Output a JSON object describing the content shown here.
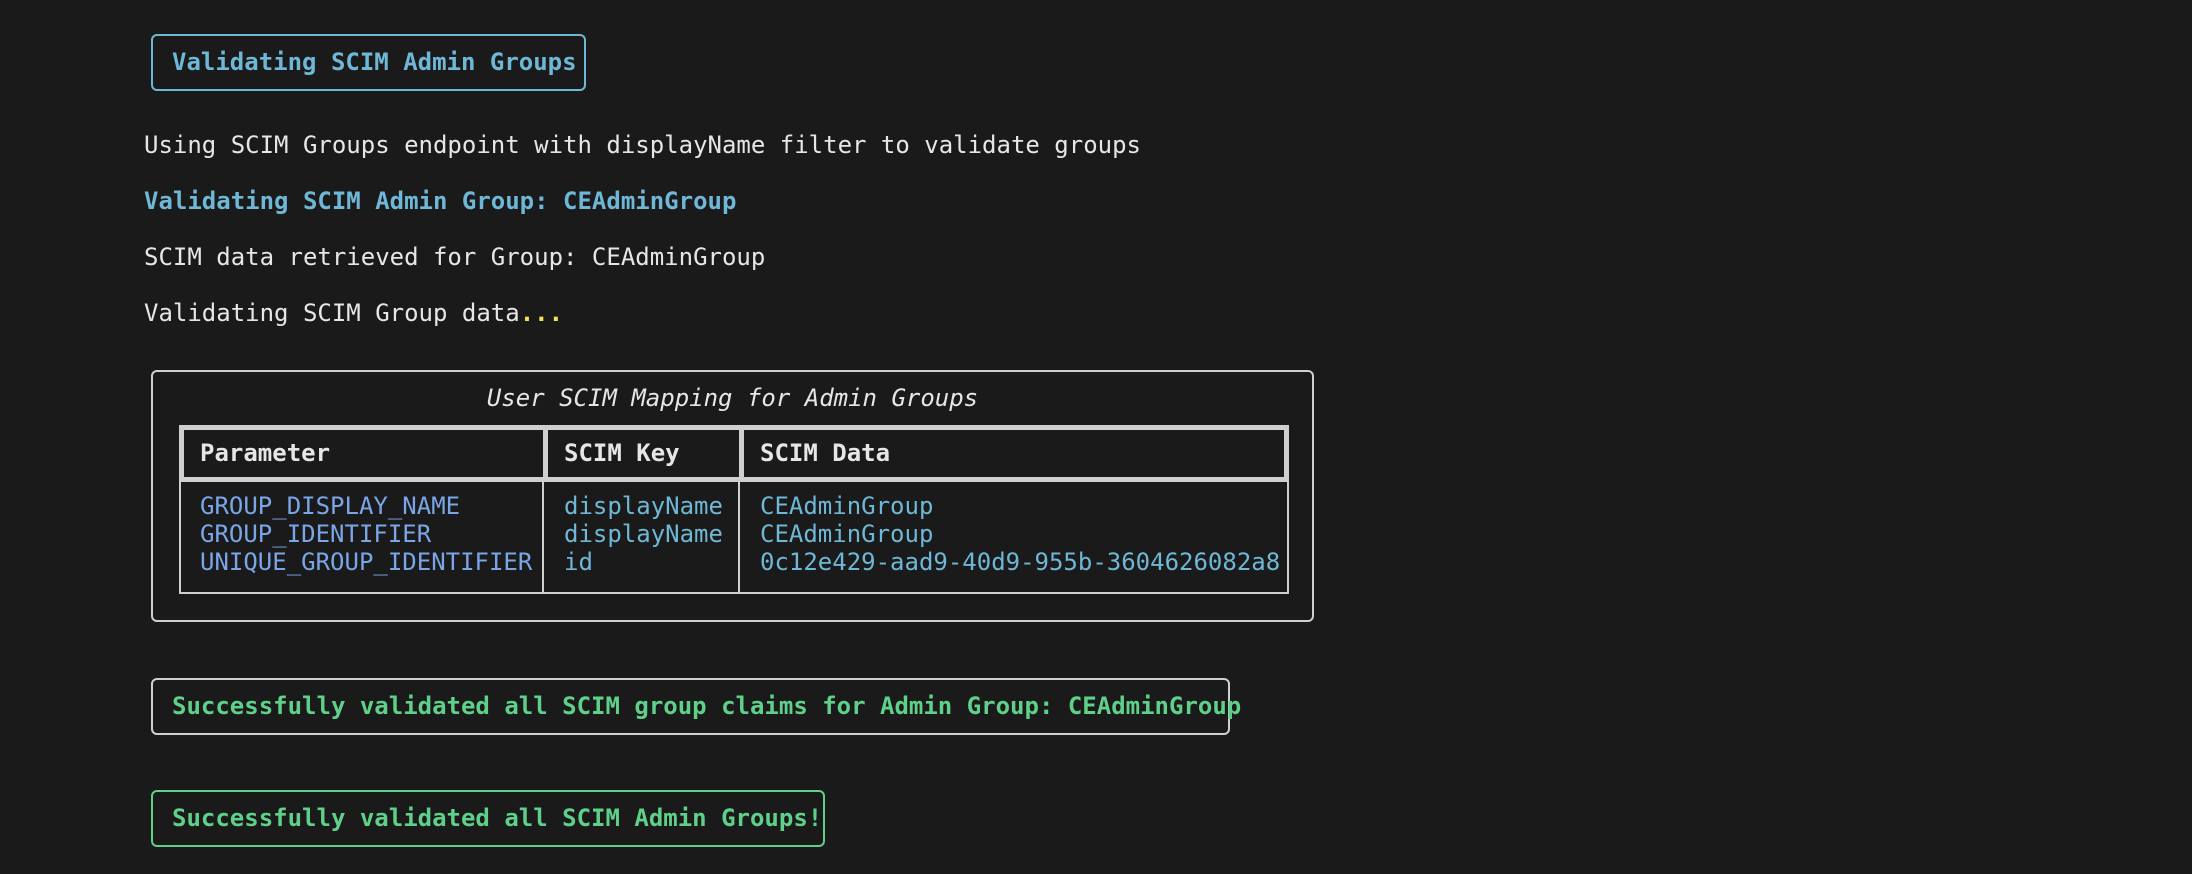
{
  "header": {
    "title": "Validating SCIM Admin Groups"
  },
  "log": {
    "line1": "Using SCIM Groups endpoint with displayName filter to validate groups",
    "line2": "Validating SCIM Admin Group: CEAdminGroup",
    "line3": "SCIM data retrieved for Group: CEAdminGroup",
    "line4_text": "Validating SCIM Group data",
    "line4_dots": "..."
  },
  "table": {
    "title": "User SCIM Mapping for Admin Groups",
    "columns": [
      "Parameter",
      "SCIM Key",
      "SCIM Data"
    ],
    "rows": [
      [
        "GROUP_DISPLAY_NAME",
        "displayName",
        "CEAdminGroup"
      ],
      [
        "GROUP_IDENTIFIER",
        "displayName",
        "CEAdminGroup"
      ],
      [
        "UNIQUE_GROUP_IDENTIFIER",
        "id",
        "0c12e429-aad9-40d9-955b-3604626082a8"
      ]
    ]
  },
  "results": {
    "claims_success": "Successfully validated all SCIM group claims for Admin Group: CEAdminGroup",
    "all_success": "Successfully validated all SCIM Admin Groups!"
  },
  "colors": {
    "background": "#1a1a1a",
    "accent_blue": "#6fb7d6",
    "param_blue": "#7aa6e8",
    "success_green": "#5fd08a",
    "ellipsis_yellow": "#f2e15a"
  }
}
